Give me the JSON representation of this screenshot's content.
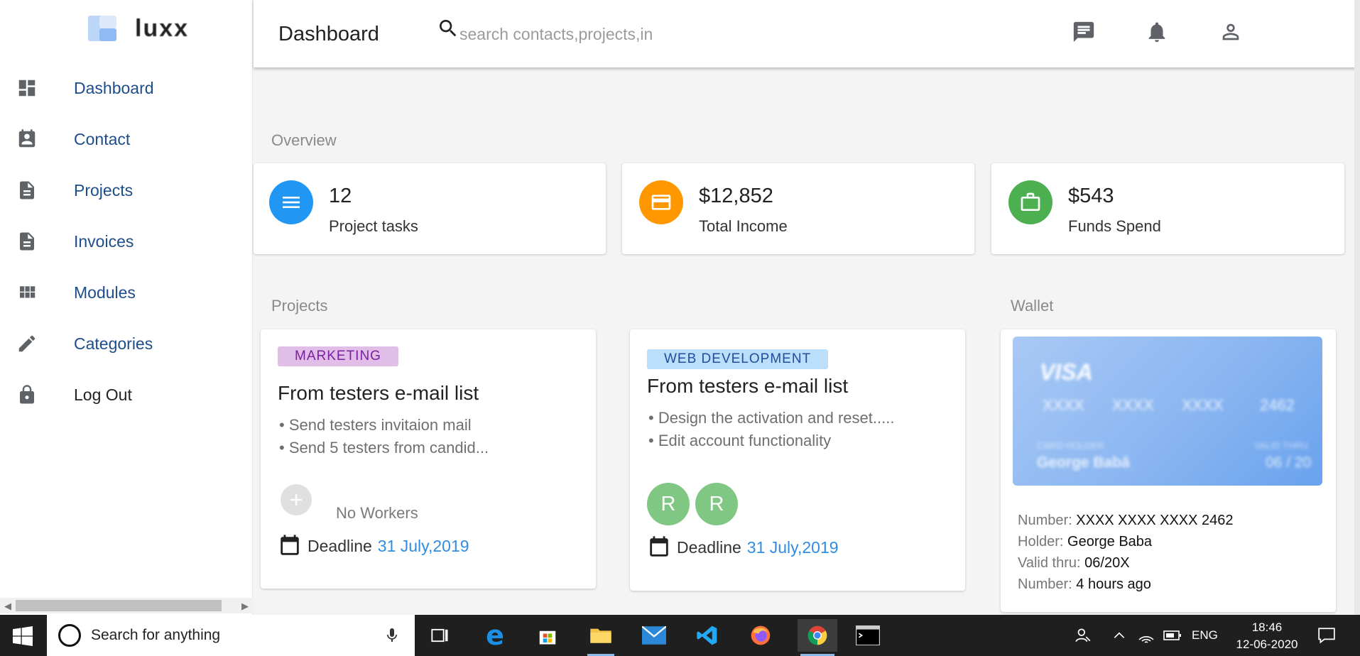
{
  "app": {
    "logo_text": "luxx"
  },
  "sidebar": {
    "items": [
      {
        "label": "Dashboard",
        "icon": "dashboard-icon"
      },
      {
        "label": "Contact",
        "icon": "contact-icon"
      },
      {
        "label": "Projects",
        "icon": "document-icon"
      },
      {
        "label": "Invoices",
        "icon": "document-icon"
      },
      {
        "label": "Modules",
        "icon": "modules-icon"
      },
      {
        "label": "Categories",
        "icon": "pencil-icon"
      },
      {
        "label": "Log Out",
        "icon": "lock-icon"
      }
    ]
  },
  "header": {
    "title": "Dashboard",
    "search_placeholder": "search contacts,projects,in"
  },
  "overview": {
    "title": "Overview",
    "stats": [
      {
        "value": "12",
        "label": "Project tasks",
        "color": "#2196f3",
        "icon": "menu-icon"
      },
      {
        "value": "$12,852",
        "label": "Total Income",
        "color": "#ff9800",
        "icon": "card-icon"
      },
      {
        "value": "$543",
        "label": "Funds Spend",
        "color": "#4caf50",
        "icon": "briefcase-icon"
      }
    ]
  },
  "projects": {
    "title": "Projects",
    "cards": [
      {
        "tag": "MARKETING",
        "tag_bg": "#e1bee7",
        "tag_color": "#7b1fa2",
        "title": "From testers e-mail list",
        "tasks": [
          "• Send testers invitaion mail",
          "• Send 5 testers from candid..."
        ],
        "workers_empty": "No Workers",
        "deadline_label": "Deadline",
        "deadline_date": "31 July,2019"
      },
      {
        "tag": "WEB DEVELOPMENT",
        "tag_bg": "#bbdefb",
        "tag_color": "#1e4e9c",
        "title": "From testers e-mail list",
        "tasks": [
          "• Design the activation and reset.....",
          "• Edit account functionality"
        ],
        "workers": [
          "R",
          "R"
        ],
        "deadline_label": "Deadline",
        "deadline_date": "31 July,2019"
      }
    ]
  },
  "wallet": {
    "title": "Wallet",
    "card": {
      "brand": "VISA",
      "groups": [
        "XXXX",
        "XXXX",
        "XXXX",
        "2462"
      ],
      "holder_label": "CARD HOLDER",
      "holder": "George Babă",
      "valid_label": "VALID THRU",
      "valid": "06 / 20"
    },
    "details": [
      {
        "label": "Number:",
        "value": "XXXX XXXX XXXX 2462"
      },
      {
        "label": "Holder:",
        "value": "George Baba"
      },
      {
        "label": "Valid thru:",
        "value": "06/20X"
      },
      {
        "label": "Number:",
        "value": "4 hours ago"
      }
    ]
  },
  "taskbar": {
    "search_text": "Search for anything",
    "language": "ENG",
    "time": "18:46",
    "date": "12-06-2020"
  }
}
